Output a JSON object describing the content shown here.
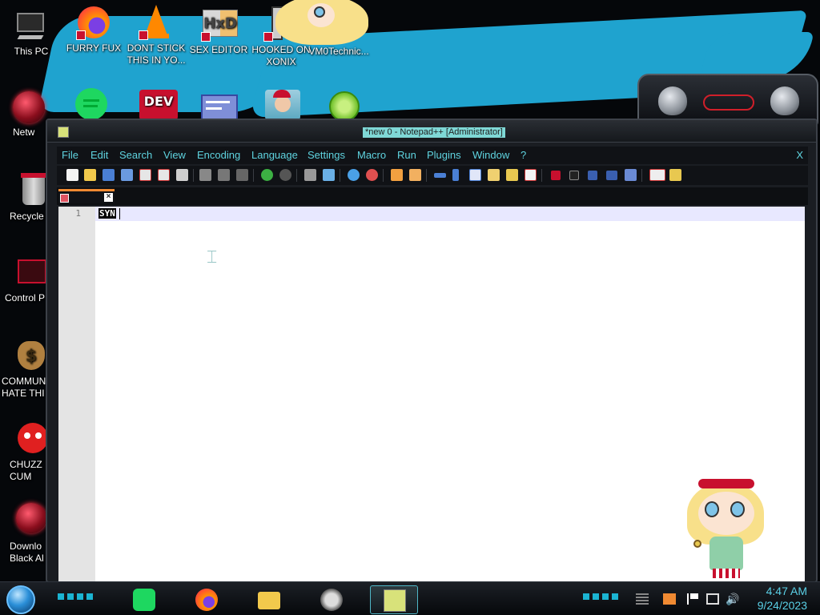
{
  "desktop": {
    "icons_top": [
      {
        "label": "This PC",
        "icon": "computer-icon"
      },
      {
        "label": "FURRY FUX",
        "icon": "firefox-icon"
      },
      {
        "label": "DONT STICK THIS IN YO...",
        "icon": "vlc-icon"
      },
      {
        "label": "SEX EDITOR",
        "icon": "hxd-icon"
      },
      {
        "label": "HOOKED ON XONIX",
        "icon": "app-icon"
      },
      {
        "label": "VM0Technic...",
        "icon": "character-icon"
      }
    ],
    "icons_left": [
      {
        "label": "Netw",
        "icon": "network-icon"
      },
      {
        "label": "Recycle",
        "icon": "recycle-bin-icon"
      },
      {
        "label": "Control P",
        "icon": "control-panel-icon"
      },
      {
        "label": "COMMUN HATE THI",
        "icon": "money-bag-icon"
      },
      {
        "label": "CHUZZ CUM",
        "icon": "chuzzle-icon"
      },
      {
        "label": "Downlo Black Al",
        "icon": "alien-orb-icon"
      }
    ],
    "icons_row2": [
      {
        "icon": "spotify-icon"
      },
      {
        "label": "DEV",
        "icon": "devcpp-icon"
      },
      {
        "icon": "window-app-icon"
      },
      {
        "icon": "santa-icon"
      },
      {
        "icon": "lime-icon"
      }
    ]
  },
  "npp": {
    "title": "*new 0 - Notepad++ [Administrator]",
    "menu": [
      "File",
      "Edit",
      "Search",
      "View",
      "Encoding",
      "Language",
      "Settings",
      "Macro",
      "Run",
      "Plugins",
      "Window",
      "?"
    ],
    "close_label": "X",
    "tab_close_label": "×",
    "line_number": "1",
    "line_text": "SYN"
  },
  "taskbar": {
    "time": "4:47 AM",
    "date": "9/24/2023",
    "apps": [
      "spotify-icon",
      "firefox-icon",
      "file-explorer-icon",
      "skull-app-icon",
      "notepadpp-icon"
    ]
  },
  "colors": {
    "menu_text": "#5fd4e0",
    "accent_tab": "#f08a32",
    "wallpaper_brush": "#1fa3cf"
  }
}
